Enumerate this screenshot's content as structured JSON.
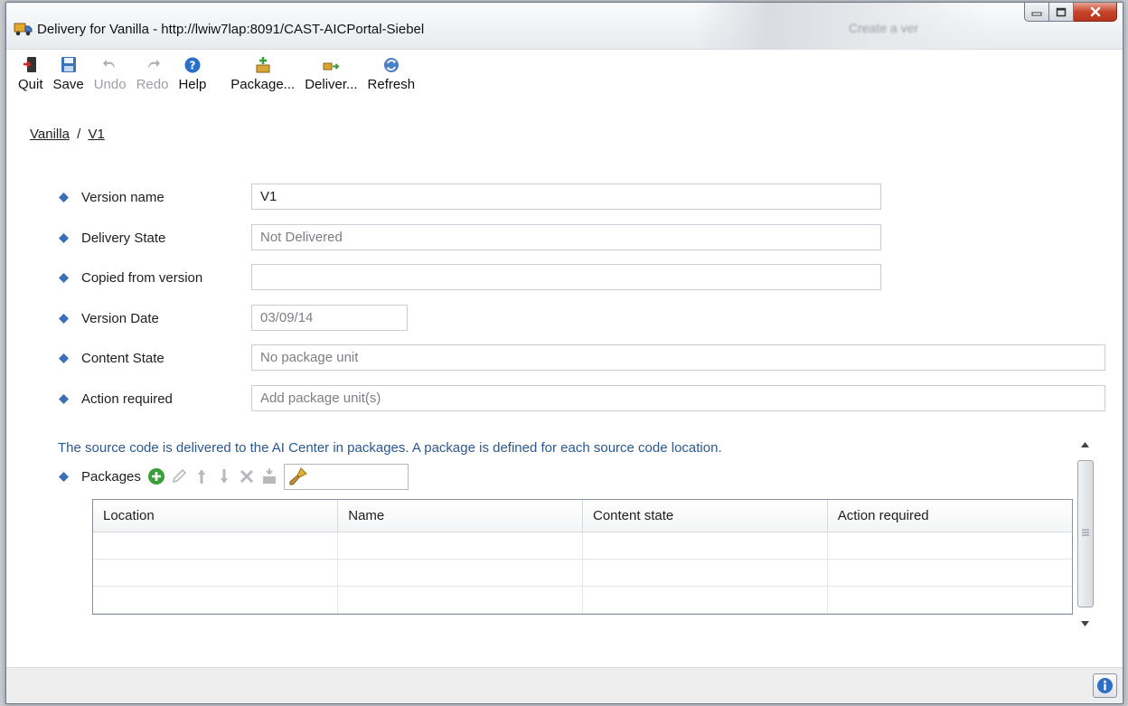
{
  "window": {
    "title": "Delivery for Vanilla - http://lwiw7lap:8091/CAST-AICPortal-Siebel",
    "background_title": "Create a ver"
  },
  "toolbar": {
    "quit": "Quit",
    "save": "Save",
    "undo": "Undo",
    "redo": "Redo",
    "help": "Help",
    "package": "Package...",
    "deliver": "Deliver...",
    "refresh": "Refresh"
  },
  "breadcrumb": {
    "parent": "Vanilla",
    "separator": "/",
    "current": "V1"
  },
  "form": {
    "version_name": {
      "label": "Version name",
      "value": "V1"
    },
    "delivery_state": {
      "label": "Delivery State",
      "value": "Not Delivered"
    },
    "copied_from": {
      "label": "Copied from version",
      "value": ""
    },
    "version_date": {
      "label": "Version Date",
      "value": "03/09/14"
    },
    "content_state": {
      "label": "Content State",
      "value": "No package unit"
    },
    "action_required": {
      "label": "Action required",
      "value": "Add package unit(s)"
    }
  },
  "packages": {
    "info_text": "The source code is delivered to the AI Center in packages. A package is defined for each source code location.",
    "label": "Packages",
    "filter_value": "",
    "columns": [
      "Location",
      "Name",
      "Content state",
      "Action required"
    ],
    "rows": [
      [
        "",
        "",
        "",
        ""
      ],
      [
        "",
        "",
        "",
        ""
      ],
      [
        "",
        "",
        "",
        ""
      ]
    ]
  },
  "colors": {
    "diamond": "#3b6fb5",
    "info_text": "#2a5890",
    "close_button": "#c7452c",
    "add_icon": "#3aa03a"
  }
}
